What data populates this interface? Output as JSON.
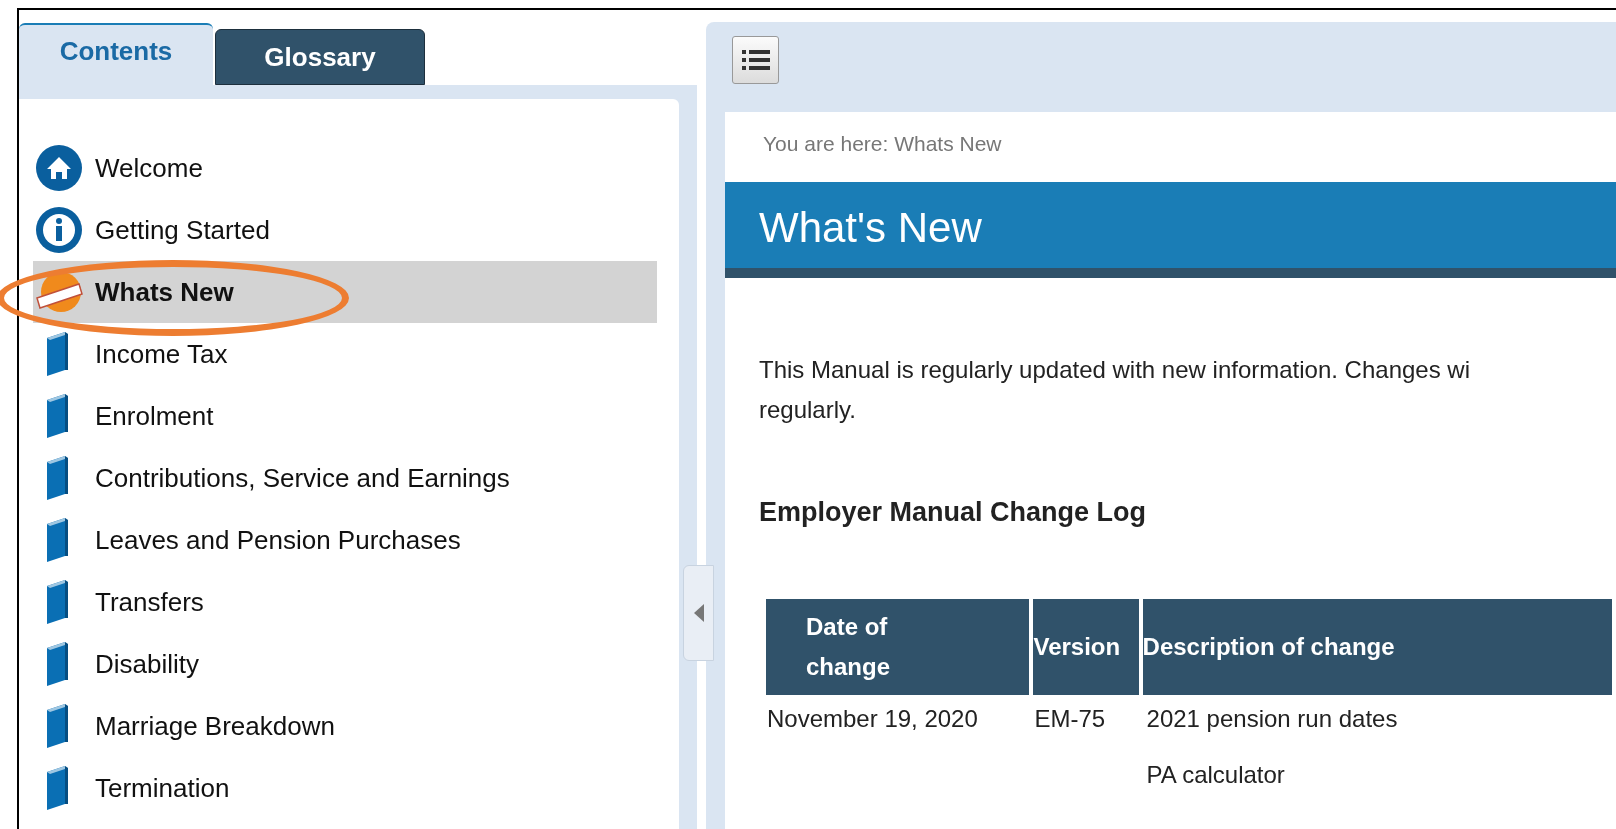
{
  "tabs": [
    {
      "label": "Contents",
      "selected": true
    },
    {
      "label": "Glossary",
      "selected": false
    }
  ],
  "toc": [
    {
      "label": "Welcome",
      "kind": "home",
      "selected": false
    },
    {
      "label": "Getting Started",
      "kind": "info",
      "selected": false
    },
    {
      "label": "Whats New",
      "kind": "new",
      "selected": true
    },
    {
      "label": "Income Tax",
      "kind": "book",
      "selected": false
    },
    {
      "label": "Enrolment",
      "kind": "book",
      "selected": false
    },
    {
      "label": "Contributions, Service and Earnings",
      "kind": "book",
      "selected": false
    },
    {
      "label": "Leaves and Pension Purchases",
      "kind": "book",
      "selected": false
    },
    {
      "label": "Transfers",
      "kind": "book",
      "selected": false
    },
    {
      "label": "Disability",
      "kind": "book",
      "selected": false
    },
    {
      "label": "Marriage Breakdown",
      "kind": "book",
      "selected": false
    },
    {
      "label": "Termination",
      "kind": "book",
      "selected": false
    }
  ],
  "annotation": {
    "kind": "ellipse",
    "color": "#ed7d31"
  },
  "breadcrumb": "You are here: Whats New",
  "page_title": "What's New",
  "intro_lines": [
    "This Manual is regularly updated with new information. Changes wi",
    "regularly."
  ],
  "section_heading": "Employer Manual Change Log",
  "table": {
    "columns": [
      "Date of change",
      "Version",
      "Description of change"
    ],
    "rows": [
      {
        "date": "November 19, 2020",
        "version": "EM-75",
        "changes": [
          "2021 pension run dates",
          "PA calculator"
        ]
      }
    ]
  }
}
